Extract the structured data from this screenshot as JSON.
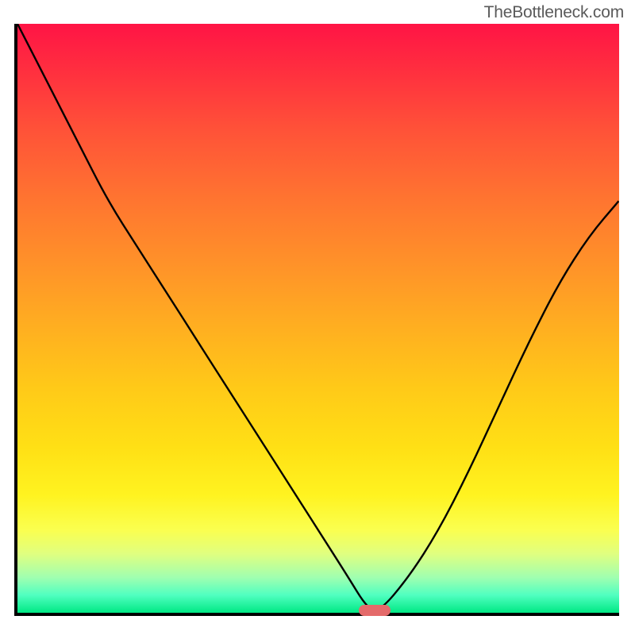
{
  "watermark": "TheBottleneck.com",
  "chart_data": {
    "type": "line",
    "title": "",
    "xlabel": "",
    "ylabel": "",
    "xlim": [
      0,
      100
    ],
    "ylim": [
      0,
      100
    ],
    "grid": false,
    "series": [
      {
        "name": "curve",
        "x": [
          0,
          5,
          10,
          15,
          20,
          25,
          30,
          35,
          40,
          45,
          50,
          55,
          58,
          60,
          65,
          70,
          75,
          80,
          85,
          90,
          95,
          100
        ],
        "values": [
          100,
          90,
          80,
          70,
          62,
          54,
          46,
          38,
          30,
          22,
          14,
          6,
          1,
          0,
          6,
          14,
          24,
          35,
          46,
          56,
          64,
          70
        ]
      }
    ],
    "marker": {
      "x": 59,
      "y": 0.5,
      "color": "#e46a6a"
    },
    "background_gradient": {
      "top": "#ff1445",
      "mid": "#ffd018",
      "bottom": "#00e884"
    }
  }
}
